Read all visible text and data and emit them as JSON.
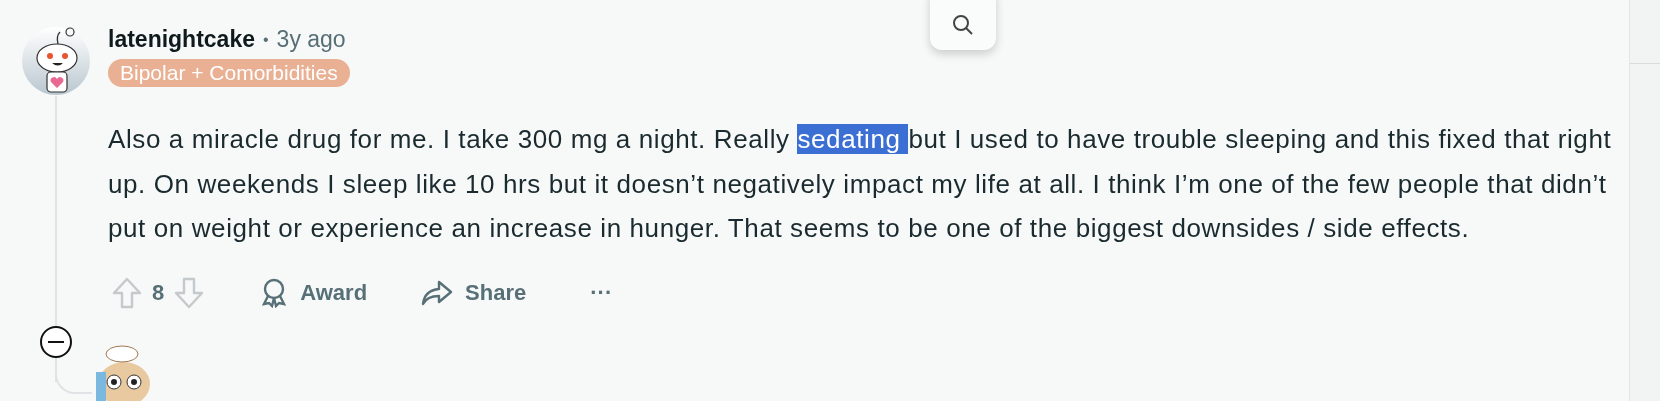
{
  "comment": {
    "author": "latenightcake",
    "separator": "•",
    "time": "3y ago",
    "flair": {
      "label": "Bipolar + Comorbidities",
      "color": "#eab094"
    },
    "body": [
      {
        "text": "Also a miracle drug for me. I take 300 mg a night. Really ",
        "selected": false
      },
      {
        "text": "sedating ",
        "selected": true
      },
      {
        "text": "but I used to have trouble sleeping and this fixed that right up. On weekends I sleep like 10 hrs but it doesn’t negatively impact my life at all. I think I’m one of the few people that didn’t put on weight or experience an increase in hunger. That seems to be one of the biggest downsides / side effects.",
        "selected": false
      }
    ],
    "score": "8",
    "expanded": true,
    "actions": [
      {
        "kind": "award",
        "label": "Award"
      },
      {
        "kind": "share",
        "label": "Share"
      },
      {
        "kind": "more",
        "label": "···"
      }
    ]
  }
}
